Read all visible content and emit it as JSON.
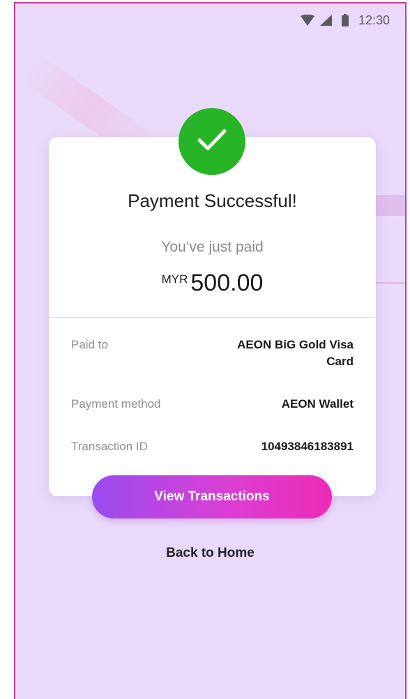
{
  "status_bar": {
    "time": "12:30",
    "icons": [
      "wifi-icon",
      "signal-icon",
      "battery-icon"
    ]
  },
  "colors": {
    "background": "#e9dafb",
    "success_green": "#27b527",
    "button_gradient_start": "#9a4cf0",
    "button_gradient_end": "#ee2ab8"
  },
  "receipt": {
    "status_icon": "checkmark-icon",
    "title": "Payment Successful!",
    "subtitle": "You’ve just paid",
    "currency": "MYR",
    "amount": "500.00",
    "details": [
      {
        "label": "Paid to",
        "value": "AEON BiG Gold Visa Card"
      },
      {
        "label": "Payment method",
        "value": "AEON Wallet"
      },
      {
        "label": "Transaction ID",
        "value": "10493846183891"
      }
    ]
  },
  "actions": {
    "view_transactions": "View Transactions",
    "back_home": "Back to Home"
  }
}
